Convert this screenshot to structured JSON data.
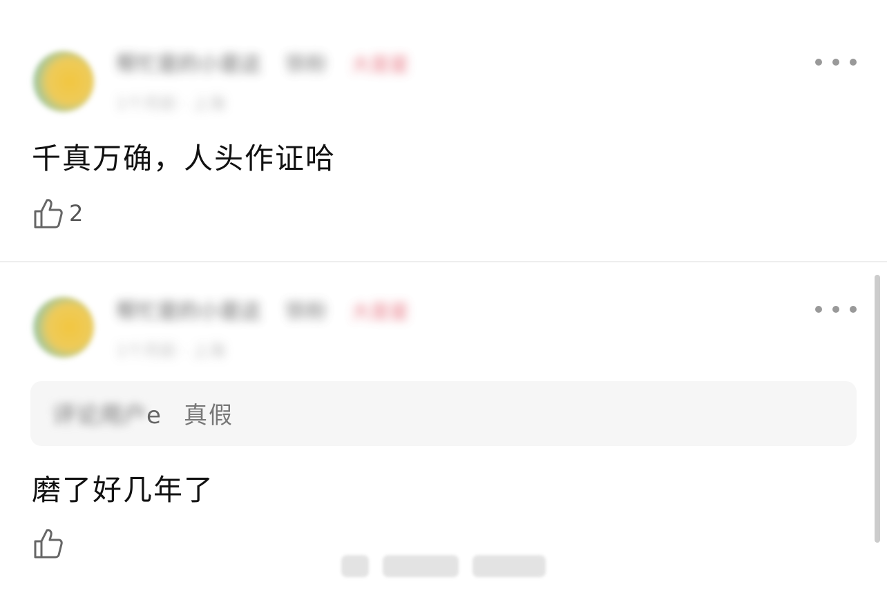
{
  "comments": [
    {
      "username": "帮忙是的小是这",
      "tag": "铁粉",
      "badge": "大是星",
      "time": "1个月前 · 上海",
      "content": "千真万确，人头作证哈",
      "like_count": "2"
    },
    {
      "username": "帮忙是的小是这",
      "tag": "铁粉",
      "badge": "大是星",
      "time": "1个月前 · 上海",
      "quote": {
        "user_hidden": "评论用户",
        "user_tail": "e",
        "text": "真假"
      },
      "content": "磨了好几年了",
      "like_count": ""
    }
  ],
  "icons": {
    "more": "more-dots-icon",
    "like": "thumbs-up-icon",
    "avatar": "avatar"
  },
  "colors": {
    "text_primary": "#111111",
    "text_secondary": "#777777",
    "badge": "#e05060",
    "quote_bg": "#f6f6f6",
    "divider": "#eeeeee"
  }
}
